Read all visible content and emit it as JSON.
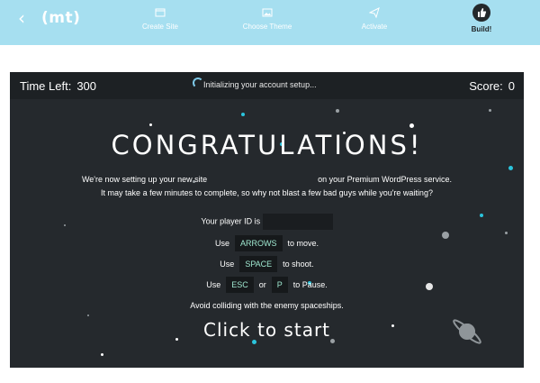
{
  "topbar": {
    "back_icon": "chevron-left-icon",
    "logo_text": "(mt)",
    "steps": [
      {
        "label": "Create Site",
        "icon": "browser-window-icon"
      },
      {
        "label": "Choose Theme",
        "icon": "image-icon"
      },
      {
        "label": "Activate",
        "icon": "paper-plane-icon"
      },
      {
        "label": "Build!",
        "icon": "thumbs-up-icon"
      }
    ],
    "colors": {
      "bar": "#a6dff0",
      "active_circle": "#23282b"
    }
  },
  "game": {
    "time_label": "Time Left:",
    "time_value": "300",
    "status_text": "Initializing your account setup...",
    "score_label": "Score:",
    "score_value": "0",
    "heading": "CONGRATULATIONS!",
    "line1_pre": "We're now setting up your new site",
    "line1_post": "on your Premium WordPress service.",
    "line2": "It may take a few minutes to complete, so why not blast a few bad guys while you're waiting?",
    "player_id_label": "Your player ID is",
    "use_word": "Use",
    "arrows_key": "ARROWS",
    "move_text": "to move.",
    "space_key": "SPACE",
    "shoot_text": "to shoot.",
    "esc_key": "ESC",
    "or_word": "or",
    "p_key": "P",
    "pause_text": "to Pause.",
    "avoid_text": "Avoid colliding with the enemy spaceships.",
    "start_text": "Click to start",
    "colors": {
      "background": "#25292d",
      "hud": "#1d2124",
      "key_text": "#9fe8d0",
      "star_cyan": "#2bc4dc"
    }
  }
}
